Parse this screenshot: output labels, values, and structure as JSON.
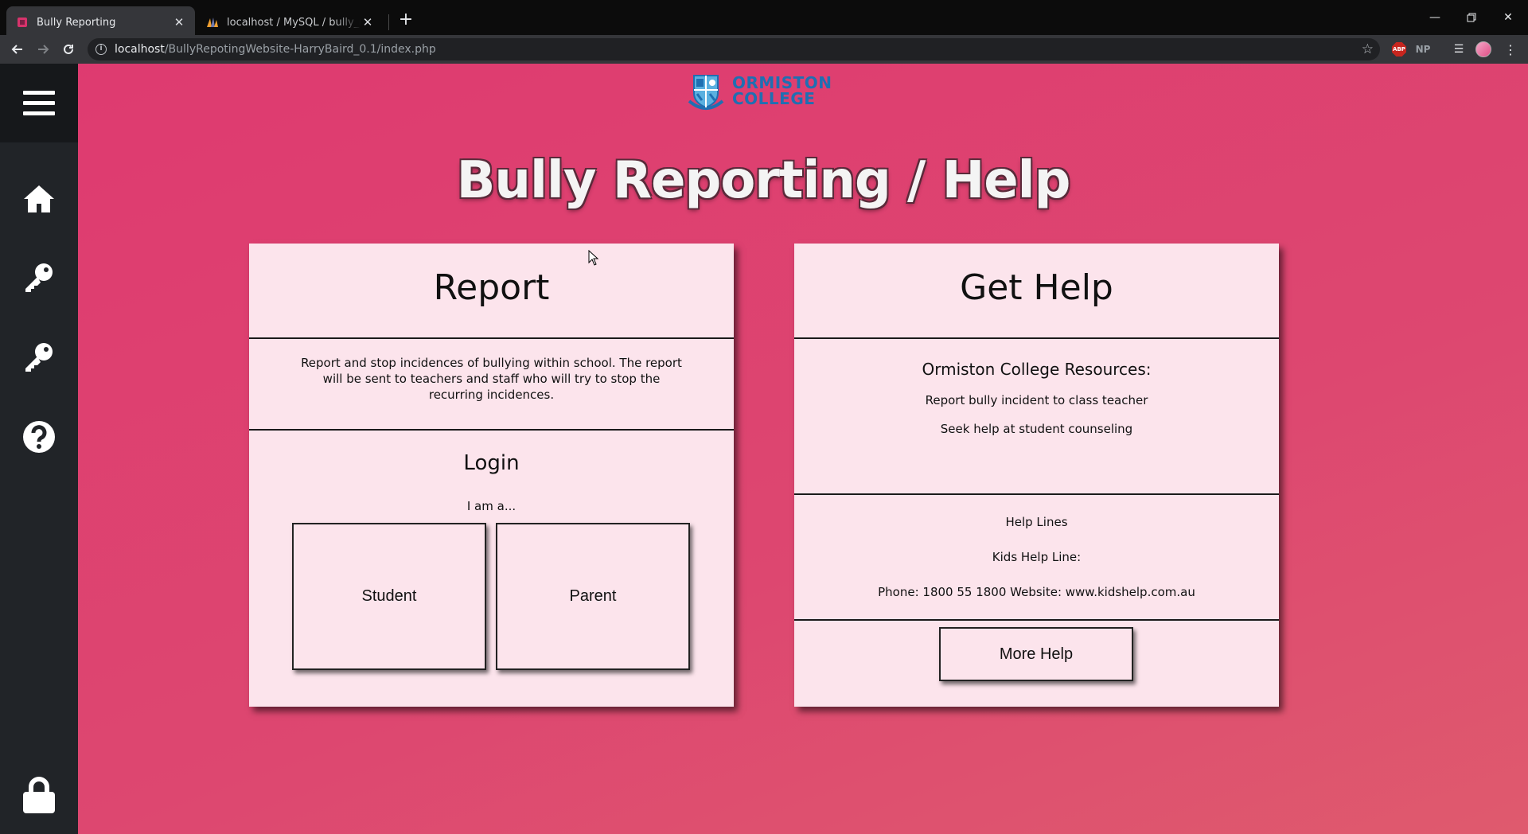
{
  "browser": {
    "tabs": [
      {
        "title": "Bully Reporting",
        "active": true
      },
      {
        "title": "localhost / MySQL / bully_reporting",
        "active": false
      }
    ],
    "url_host": "localhost",
    "url_path": "/BullyRepotingWebsite-HarryBaird_0.1/index.php",
    "extensions": {
      "adblock": "ABP",
      "np": "NP"
    }
  },
  "logo": {
    "line1": "ORMISTON",
    "line2": "COLLEGE"
  },
  "headline": "Bully Reporting / Help",
  "report_card": {
    "title": "Report",
    "description": "Report and stop incidences of bullying within school. The report will be sent to teachers and staff who will try to stop the recurring incidences.",
    "login_title": "Login",
    "prompt": "I am a...",
    "student_label": "Student",
    "parent_label": "Parent"
  },
  "help_card": {
    "title": "Get Help",
    "resources_title": "Ormiston College Resources:",
    "resource_1": "Report bully incident to class teacher",
    "resource_2": "Seek help at student counseling",
    "helplines_title": "Help Lines",
    "kids_line": "Kids Help Line:",
    "contact": "Phone: 1800 55 1800 Website: www.kidshelp.com.au",
    "more_help_label": "More Help"
  },
  "colors": {
    "page_bg": "#de3a70",
    "card_bg": "#fce4ec",
    "sidebar_bg": "#212428",
    "logo_blue": "#1f6fb2"
  },
  "icons": [
    "hamburger-icon",
    "home-icon",
    "key-icon",
    "key-icon",
    "question-icon",
    "lock-icon"
  ]
}
